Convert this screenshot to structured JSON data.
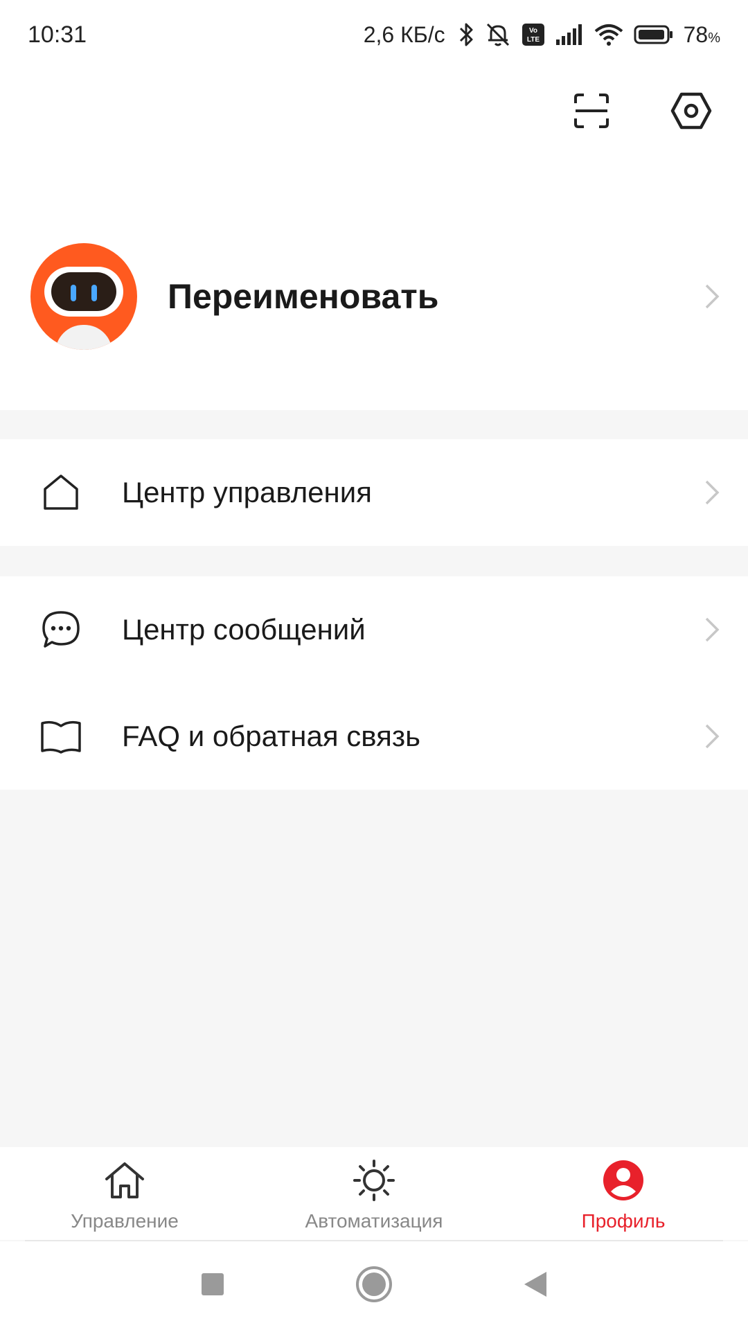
{
  "status_bar": {
    "time": "10:31",
    "speed": "2,6 КБ/с",
    "volte": "VoLTE",
    "battery_pct": "78",
    "battery_unit": "%"
  },
  "header": {
    "scan_icon": "scan-icon",
    "settings_icon": "settings-hex-icon"
  },
  "profile": {
    "name": "Переименовать",
    "avatar": "robot-avatar"
  },
  "menu": {
    "control_center": {
      "label": "Центр управления",
      "icon": "home-outline-icon"
    },
    "message_center": {
      "label": "Центр сообщений",
      "icon": "chat-bubble-icon"
    },
    "faq": {
      "label": "FAQ и обратная связь",
      "icon": "open-book-icon"
    }
  },
  "tabs": [
    {
      "label": "Управление",
      "icon": "home-icon",
      "active": false
    },
    {
      "label": "Автоматизация",
      "icon": "sun-icon",
      "active": false
    },
    {
      "label": "Профиль",
      "icon": "profile-icon",
      "active": true
    }
  ],
  "colors": {
    "accent": "#e8212b",
    "avatar_orange": "#ff5a1f",
    "background": "#f6f6f6",
    "chevron": "#c7c7c7"
  }
}
